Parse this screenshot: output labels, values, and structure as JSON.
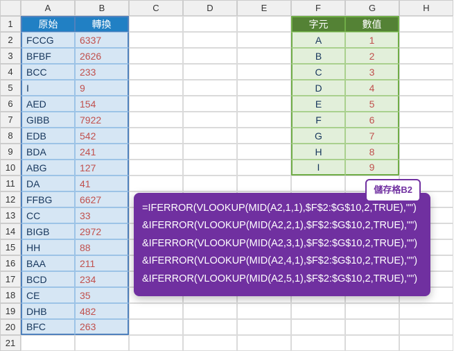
{
  "columns": [
    "A",
    "B",
    "C",
    "D",
    "E",
    "F",
    "G",
    "H"
  ],
  "rows": [
    "1",
    "2",
    "3",
    "4",
    "5",
    "6",
    "7",
    "8",
    "9",
    "10",
    "11",
    "12",
    "13",
    "14",
    "15",
    "16",
    "17",
    "18",
    "19",
    "20",
    "21"
  ],
  "tableAB": {
    "headers": {
      "col1": "原始",
      "col2": "轉換"
    },
    "data": [
      {
        "a": "FCCG",
        "b": "6337"
      },
      {
        "a": "BFBF",
        "b": "2626"
      },
      {
        "a": "BCC",
        "b": "233"
      },
      {
        "a": "I",
        "b": "9"
      },
      {
        "a": "AED",
        "b": "154"
      },
      {
        "a": "GIBB",
        "b": "7922"
      },
      {
        "a": "EDB",
        "b": "542"
      },
      {
        "a": "BDA",
        "b": "241"
      },
      {
        "a": "ABG",
        "b": "127"
      },
      {
        "a": "DA",
        "b": "41"
      },
      {
        "a": "FFBG",
        "b": "6627"
      },
      {
        "a": "CC",
        "b": "33"
      },
      {
        "a": "BIGB",
        "b": "2972"
      },
      {
        "a": "HH",
        "b": "88"
      },
      {
        "a": "BAA",
        "b": "211"
      },
      {
        "a": "BCD",
        "b": "234"
      },
      {
        "a": "CE",
        "b": "35"
      },
      {
        "a": "DHB",
        "b": "482"
      },
      {
        "a": "BFC",
        "b": "263"
      }
    ]
  },
  "tableFG": {
    "headers": {
      "col1": "字元",
      "col2": "數值"
    },
    "data": [
      {
        "f": "A",
        "g": "1"
      },
      {
        "f": "B",
        "g": "2"
      },
      {
        "f": "C",
        "g": "3"
      },
      {
        "f": "D",
        "g": "4"
      },
      {
        "f": "E",
        "g": "5"
      },
      {
        "f": "F",
        "g": "6"
      },
      {
        "f": "G",
        "g": "7"
      },
      {
        "f": "H",
        "g": "8"
      },
      {
        "f": "I",
        "g": "9"
      }
    ]
  },
  "formula": {
    "tag": "儲存格B2",
    "lines": [
      "=IFERROR(VLOOKUP(MID(A2,1,1),$F$2:$G$10,2,TRUE),\"\")",
      "&IFERROR(VLOOKUP(MID(A2,2,1),$F$2:$G$10,2,TRUE),\"\")",
      "&IFERROR(VLOOKUP(MID(A2,3,1),$F$2:$G$10,2,TRUE),\"\")",
      "&IFERROR(VLOOKUP(MID(A2,4,1),$F$2:$G$10,2,TRUE),\"\")",
      "&IFERROR(VLOOKUP(MID(A2,5,1),$F$2:$G$10,2,TRUE),\"\")"
    ]
  }
}
